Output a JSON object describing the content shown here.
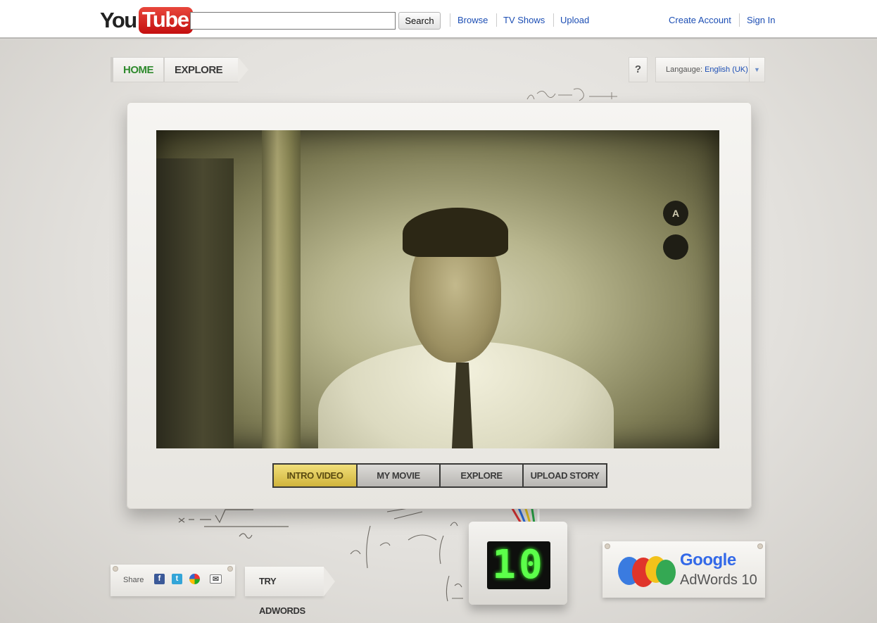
{
  "header": {
    "logo_you": "You",
    "logo_tube": "Tube",
    "search_value": "",
    "search_button": "Search",
    "nav": [
      "Browse",
      "TV Shows",
      "Upload"
    ],
    "account": [
      "Create Account",
      "Sign In"
    ]
  },
  "crumbs": {
    "home": "HOME",
    "explore": "EXPLORE"
  },
  "help_label": "?",
  "language": {
    "label": "Langauge:",
    "value": "English (UK)"
  },
  "video_tabs": [
    {
      "label": "INTRO VIDEO",
      "active": true
    },
    {
      "label": "MY MOVIE",
      "active": false
    },
    {
      "label": "EXPLORE",
      "active": false
    },
    {
      "label": "UPLOAD STORY",
      "active": false
    }
  ],
  "share": {
    "label": "Share"
  },
  "try_adwords": "TRY ADWORDS",
  "counter_value": "10",
  "adwords_card": {
    "google": "Google",
    "adwords": "AdWords 10"
  },
  "colors": {
    "link": "#1c4eb4",
    "home_green": "#2f8a2e",
    "tab_active": "#d9bf49",
    "counter_green": "#5cff4a",
    "youtube_red": "#d11f1f"
  },
  "icons": [
    "facebook-icon",
    "twitter-icon",
    "buzz-icon",
    "email-icon",
    "dropdown-arrow-icon"
  ]
}
